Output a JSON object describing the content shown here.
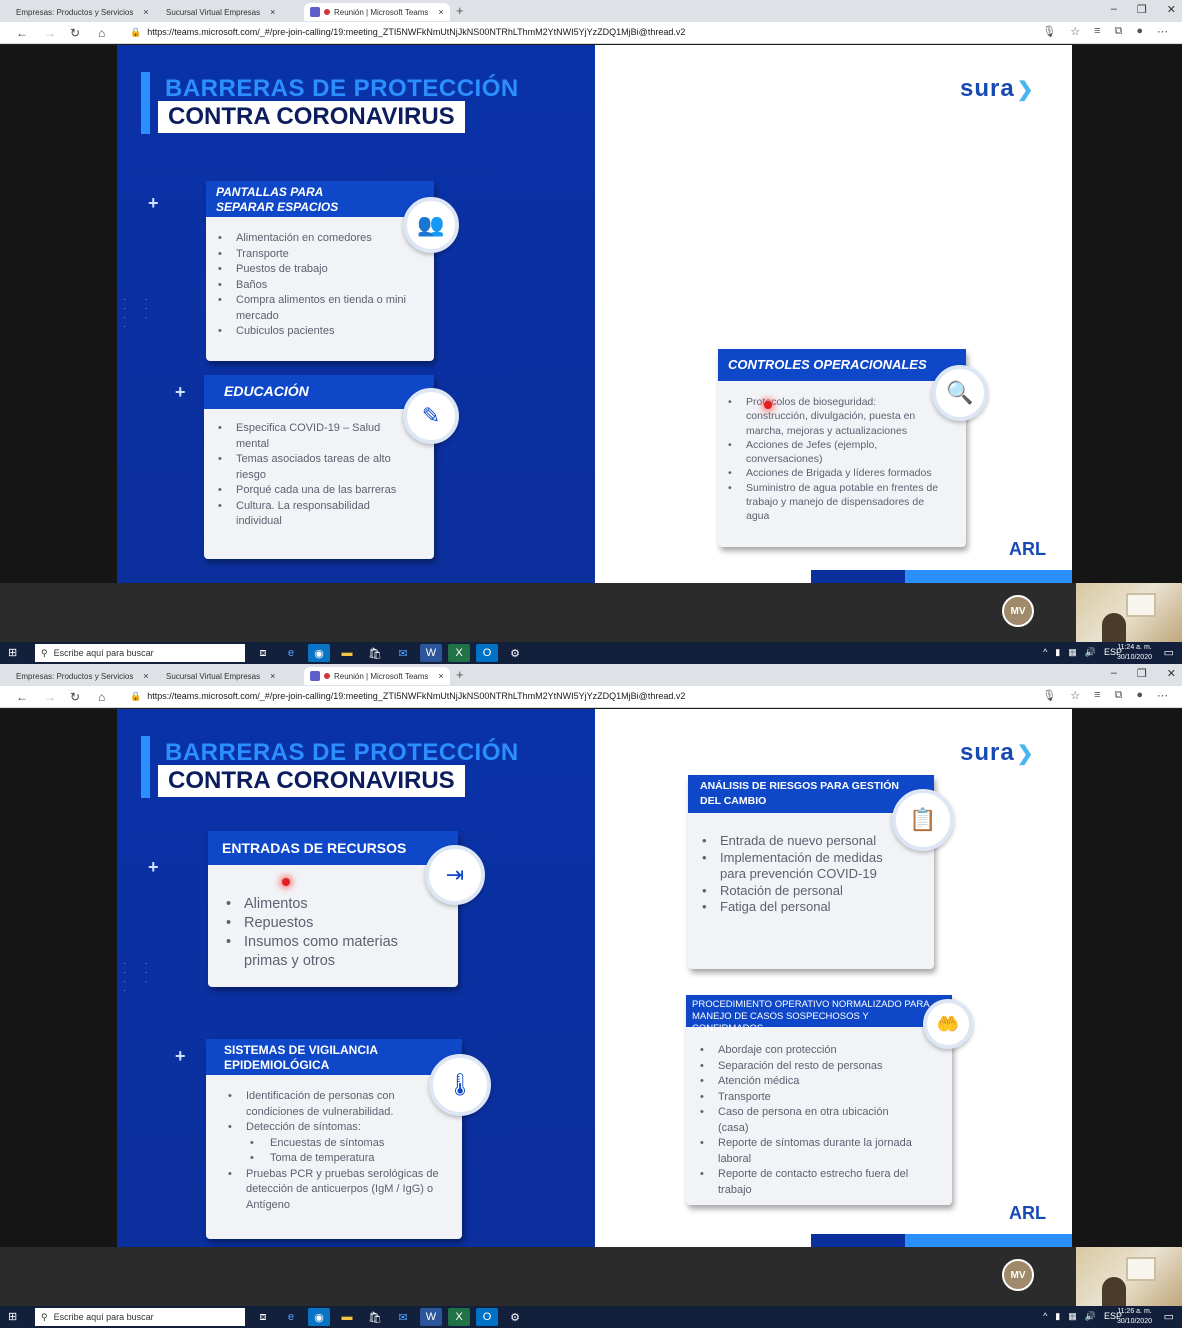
{
  "frames": [
    {
      "browser": {
        "tabs": [
          "Empresas: Productos y Servicios",
          "Sucursal Virtual Empresas",
          "Reunión | Microsoft Teams"
        ],
        "url": "https://teams.microsoft.com/_#/pre-join-calling/19:meeting_ZTI5NWFkNmUtNjJkNS00NTRhLThmM2YtNWI5YjYzZDQ1MjBi@thread.v2"
      },
      "slide": {
        "title_line1": "BARRERAS DE PROTECCIÓN",
        "title_line2": "CONTRA CORONAVIRUS",
        "brand": "sura",
        "arl": "ARL",
        "card1": {
          "title": "PANTALLAS PARA SEPARAR ESPACIOS",
          "icon": "people-screen-icon",
          "items": [
            "Alimentación en comedores",
            "Transporte",
            "Puestos de trabajo",
            "Baños",
            "Compra alimentos en tienda o mini mercado",
            "Cubiculos pacientes"
          ]
        },
        "card2": {
          "title": "EDUCACIÓN",
          "icon": "pencil-icon",
          "items": [
            "Especifica COVID-19 – Salud mental",
            "Temas asociados tareas de alto riesgo",
            "Porqué cada una de las barreras",
            "Cultura. La responsabilidad individual"
          ]
        },
        "card3": {
          "title": "CONTROLES OPERACIONALES",
          "icon": "magnifier-icon",
          "items": [
            "Protocolos de bioseguridad: construcción, divulgación, puesta en marcha, mejoras y actualizaciones",
            "Acciones de Jefes (ejemplo, conversaciones)",
            "Acciones de Brigada y líderes formados",
            "Suministro de agua potable en frentes de trabajo y manejo de dispensadores de agua"
          ]
        }
      },
      "meeting": {
        "avatar": "MV"
      },
      "taskbar": {
        "search_placeholder": "Escribe aquí para buscar",
        "lang": "ESP",
        "time": "11:24 a. m.",
        "date": "30/10/2020"
      }
    },
    {
      "browser": {
        "tabs": [
          "Empresas: Productos y Servicios",
          "Sucursal Virtual Empresas",
          "Reunión | Microsoft Teams"
        ],
        "url": "https://teams.microsoft.com/_#/pre-join-calling/19:meeting_ZTI5NWFkNmUtNjJkNS00NTRhLThmM2YtNWI5YjYzZDQ1MjBi@thread.v2"
      },
      "slide": {
        "title_line1": "BARRERAS DE PROTECCIÓN",
        "title_line2": "CONTRA CORONAVIRUS",
        "brand": "sura",
        "arl": "ARL",
        "card1": {
          "title": "ENTRADAS DE RECURSOS",
          "icon": "door-entry-icon",
          "items": [
            "Alimentos",
            "Repuestos",
            "Insumos como materias primas y otros"
          ]
        },
        "card2": {
          "title": "SISTEMAS DE VIGILANCIA EPIDEMIOLÓGICA",
          "icon": "thermometer-icon",
          "items": [
            "Identificación de personas con condiciones de vulnerabilidad.",
            "Detección de síntomas:",
            "Encuestas de síntomas",
            "Toma de temperatura",
            "Pruebas PCR y pruebas serológicas de detección de anticuerpos (IgM / IgG) o Antígeno"
          ]
        },
        "card3": {
          "title": "ANÁLISIS DE RIESGOS PARA GESTIÓN DEL CAMBIO",
          "icon": "clipboard-icon",
          "items": [
            "Entrada de nuevo personal",
            "Implementación de medidas para prevención COVID-19",
            "Rotación de personal",
            "Fatiga del personal"
          ]
        },
        "card4": {
          "title": "PROCEDIMIENTO OPERATIVO NORMALIZADO PARA MANEJO DE CASOS SOSPECHOSOS Y CONFIRMADOS",
          "icon": "hand-people-icon",
          "items": [
            "Abordaje con protección",
            "Separación del resto de personas",
            "Atención médica",
            "Transporte",
            "Caso de persona en otra ubicación (casa)",
            "Reporte de síntomas durante la jornada laboral",
            "Reporte de contacto estrecho fuera del trabajo"
          ]
        }
      },
      "meeting": {
        "avatar": "MV"
      },
      "taskbar": {
        "search_placeholder": "Escribe aquí para buscar",
        "lang": "ESP",
        "time": "11:26 a. m.",
        "date": "30/10/2020"
      }
    }
  ]
}
